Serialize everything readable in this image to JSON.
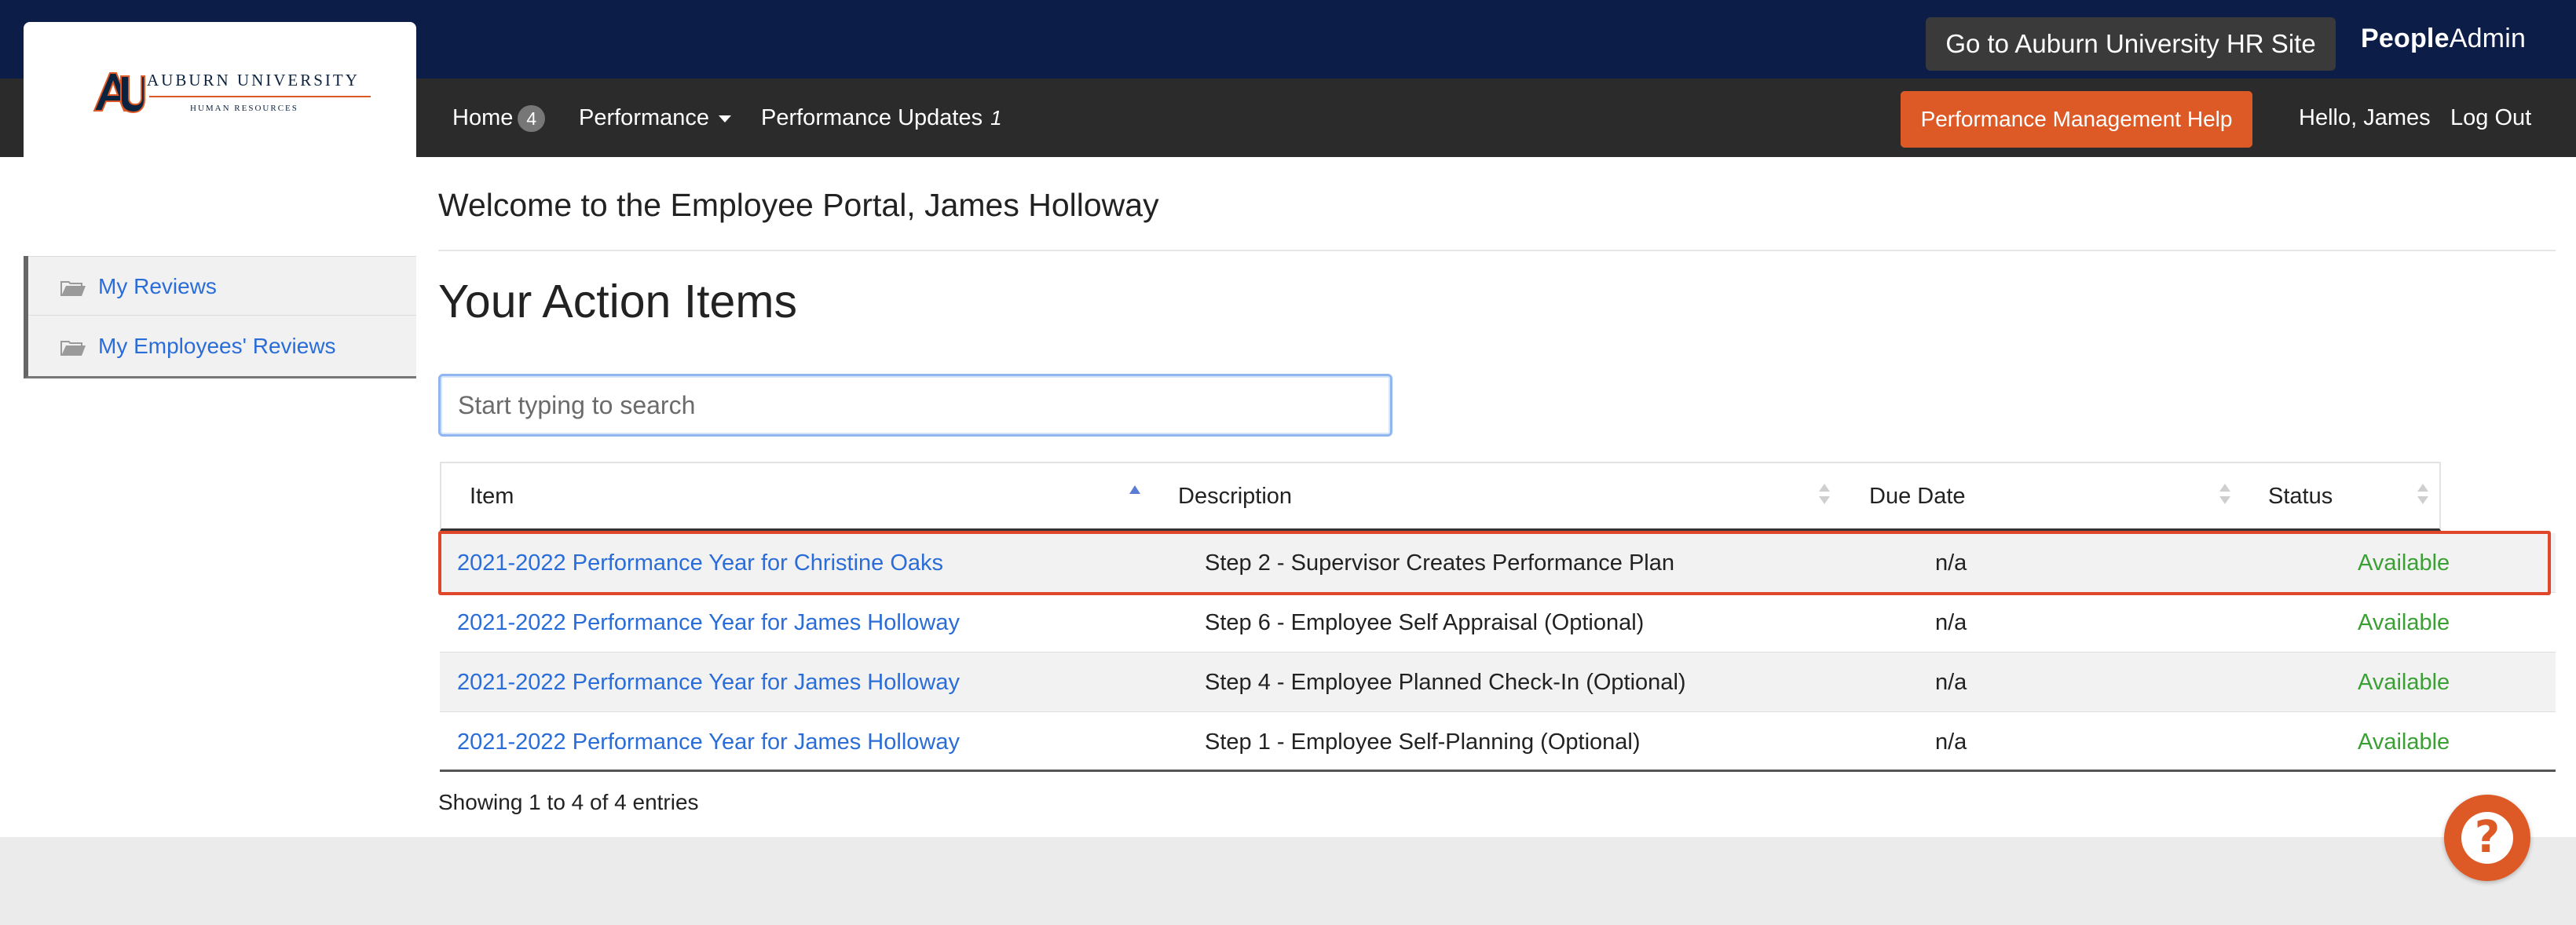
{
  "header": {
    "hr_site_button": "Go to Auburn University HR Site",
    "brand_bold": "People",
    "brand_regular": "Admin"
  },
  "logo": {
    "line1": "AUBURN UNIVERSITY",
    "line2": "HUMAN RESOURCES",
    "mark": "AU"
  },
  "nav": {
    "home": "Home",
    "home_badge": "4",
    "performance": "Performance",
    "performance_updates": "Performance Updates",
    "performance_updates_count": "1",
    "help_button": "Performance Management Help",
    "greeting": "Hello, James",
    "logout": "Log Out"
  },
  "sidebar": {
    "items": [
      {
        "label": "My Reviews",
        "icon": "folder-open-icon"
      },
      {
        "label": "My Employees' Reviews",
        "icon": "folder-open-icon"
      }
    ]
  },
  "main": {
    "welcome": "Welcome to the Employee Portal, James Holloway",
    "title": "Your Action Items",
    "search_placeholder": "Start typing to search",
    "columns": [
      "Item",
      "Description",
      "Due Date",
      "Status"
    ],
    "rows": [
      {
        "item": "2021-2022 Performance Year for Christine Oaks",
        "description": "Step 2 - Supervisor Creates Performance Plan",
        "due": "n/a",
        "status": "Available"
      },
      {
        "item": "2021-2022 Performance Year for James Holloway",
        "description": "Step 6 - Employee Self Appraisal (Optional)",
        "due": "n/a",
        "status": "Available"
      },
      {
        "item": "2021-2022 Performance Year for James Holloway",
        "description": "Step 4 - Employee Planned Check-In (Optional)",
        "due": "n/a",
        "status": "Available"
      },
      {
        "item": "2021-2022 Performance Year for James Holloway",
        "description": "Step 1 - Employee Self-Planning (Optional)",
        "due": "n/a",
        "status": "Available"
      }
    ],
    "entries_info": "Showing 1 to 4 of 4 entries"
  },
  "help_fab": {
    "icon": "question-mark-icon",
    "glyph": "?"
  },
  "colors": {
    "topbar": "#0c1d47",
    "navbar": "#2b2b2b",
    "accent_orange": "#dd5a26",
    "link_blue": "#2a6dd8",
    "status_green": "#3aa034",
    "highlight_red": "#e0472a"
  }
}
